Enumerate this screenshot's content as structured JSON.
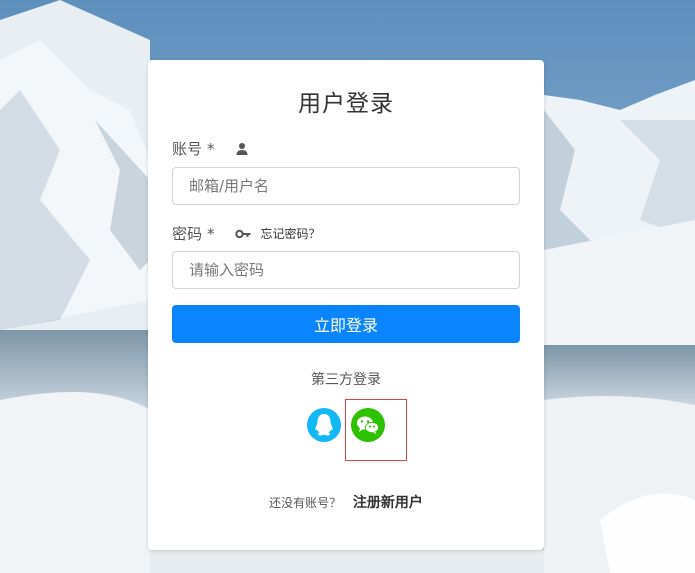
{
  "page": {
    "title": "用户登录"
  },
  "account": {
    "label": "账号",
    "required_mark": "*",
    "icon": "user-icon",
    "placeholder": "邮箱/用户名",
    "value": ""
  },
  "password": {
    "label": "密码",
    "required_mark": "*",
    "icon": "key-icon",
    "forgot_link": "忘记密码？",
    "placeholder": "请输入密码",
    "value": ""
  },
  "login_button": {
    "label": "立即登录"
  },
  "third_party": {
    "title": "第三方登录",
    "providers": [
      {
        "icon": "qq-icon",
        "color": "#12b7f5"
      },
      {
        "icon": "wechat-icon",
        "color": "#2dc100"
      }
    ]
  },
  "register": {
    "prompt": "还没有账号？",
    "link": "注册新用户"
  },
  "colors": {
    "primary": "#0a84ff",
    "qq": "#12b7f5",
    "wechat": "#2dc100",
    "highlight_frame": "#d64545"
  }
}
